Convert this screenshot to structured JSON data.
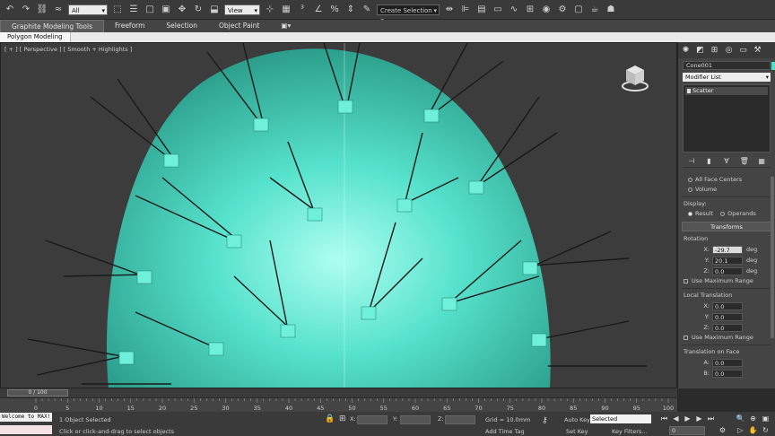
{
  "toolbar": {
    "filter": "All",
    "refcoord": "View",
    "selection_set": "Create Selection Se",
    "icons": [
      "undo-icon",
      "redo-icon",
      "link-icon",
      "unlink-icon",
      "bind-icon",
      "select-icon",
      "select-by-name-icon",
      "rect-region-icon",
      "window-crossing-icon",
      "move-icon",
      "rotate-icon",
      "scale-icon",
      "pivot-icon",
      "snap-icon",
      "angle-snap-icon",
      "percent-snap-icon",
      "spinner-snap-icon",
      "mirror-icon",
      "align-icon",
      "layer-icon",
      "curve-editor-icon",
      "schematic-icon",
      "material-editor-icon",
      "render-setup-icon",
      "render-frame-icon",
      "render-icon",
      "teapot-icon"
    ]
  },
  "ribbon": {
    "tabs": [
      "Graphite Modeling Tools",
      "Freeform",
      "Selection",
      "Object Paint"
    ],
    "sub": "Polygon Modeling"
  },
  "viewport": {
    "label": "[ + ] [ Perspective ] [ Smooth + Highlights ]"
  },
  "panel": {
    "object_name": "Cone001",
    "object_color": "#4fe0c8",
    "modifier_list": "Modifier List",
    "stack_item": "Scatter",
    "all_face_centers": "All Face Centers",
    "volume": "Volume",
    "display_label": "Display:",
    "result": "Result",
    "operands": "Operands",
    "transforms": "Transforms",
    "rotation": "Rotation",
    "rot_x": "-29.7",
    "rot_y": "20.1",
    "rot_z": "0.0",
    "unit_deg": "deg",
    "use_max_range": "Use Maximum Range",
    "local_translation": "Local Translation",
    "lt_x": "0.0",
    "lt_y": "0.0",
    "lt_z": "0.0",
    "translation_on_face": "Translation on Face",
    "tf_a": "0.0",
    "tf_b": "0.0"
  },
  "timeline": {
    "slider": "0 / 100",
    "ticks": [
      "0",
      "5",
      "10",
      "15",
      "20",
      "25",
      "30",
      "35",
      "40",
      "45",
      "50",
      "55",
      "60",
      "65",
      "70",
      "75",
      "80",
      "85",
      "90",
      "95",
      "100"
    ]
  },
  "status": {
    "maxscript": "Welcome to MAX!",
    "selected": "1 Object Selected",
    "prompt": "Click or click-and-drag to select objects",
    "x": "X:",
    "y": "Y:",
    "z": "Z:",
    "grid": "Grid = 10.0mm",
    "add_time_tag": "Add Time Tag",
    "auto_key": "Auto Key",
    "auto_key_set": "Selected",
    "set_key": "Set Key",
    "key_filters": "Key Filters...",
    "frame": "0"
  }
}
